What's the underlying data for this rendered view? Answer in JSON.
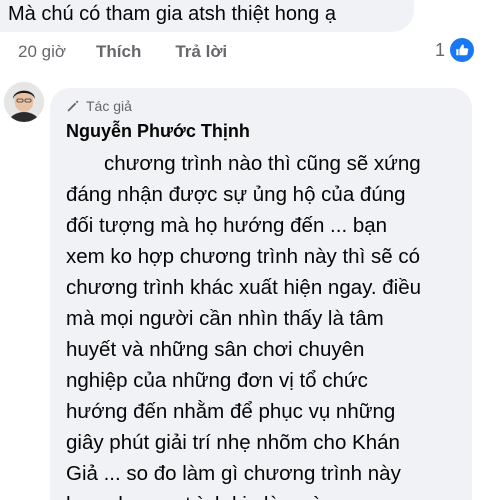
{
  "previous_comment": {
    "text": "Mà chú có tham gia atsh thiệt hong ạ",
    "time": "20 giờ",
    "like_label": "Thích",
    "reply_label": "Trả lời",
    "reaction_count": "1",
    "reaction_icon": "like-thumbs-up-icon",
    "reaction_color": "#1877f2"
  },
  "reply": {
    "badge_label": "Tác giả",
    "author": "Nguyễn Phước Thịnh",
    "lines": [
      "chương trình nào thì cũng sẽ xứng",
      "đáng nhận được sự ủng hộ của đúng",
      "đối tượng mà họ hướng đến ... bạn",
      "xem ko hợp chương trình này thì sẽ có",
      "chương trình khác xuất hiện ngay. điều",
      "mà mọi người cần nhìn thấy là tâm",
      "huyết và những sân chơi chuyên",
      "nghiệp của những đơn vị tổ chức",
      "hướng đến nhằm để phục vụ những",
      "giây phút giải trí nhẹ nhõm cho Khán",
      "Giả ... so đo làm gì chương trình này",
      "hơn chương trình kia làm gì ..."
    ]
  },
  "colors": {
    "bubble_bg": "#f0f2f5",
    "secondary_text": "#65676b",
    "primary_text": "#050505"
  }
}
